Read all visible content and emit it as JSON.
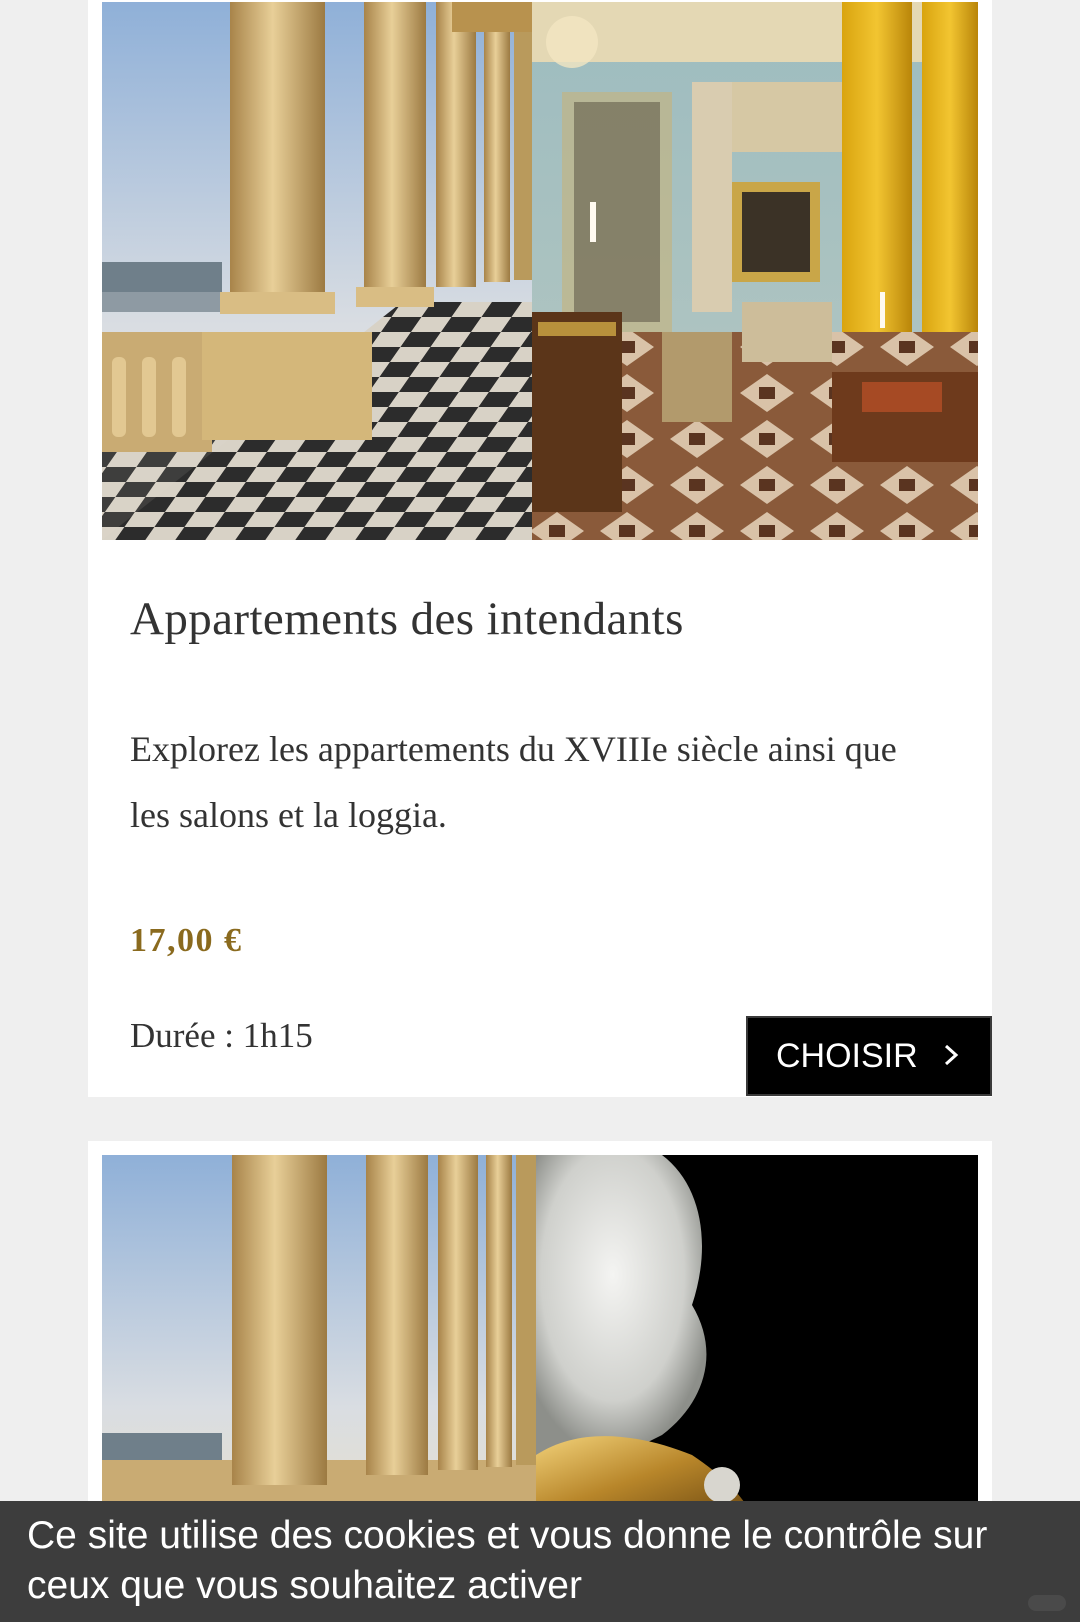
{
  "offers": [
    {
      "image_icon": "colonnade-and-salon-photo",
      "title": "Appartements des intendants",
      "description": "Explorez les appartements du XVIIIe siècle ainsi que les salons et la loggia.",
      "price": "17,00 €",
      "duration": "Durée : 1h15",
      "button_label": "CHOISIR"
    },
    {
      "image_icon": "colonnade-and-bust-photo"
    }
  ],
  "cookie_banner": {
    "text": "Ce site utilise des cookies et vous donne le contrôle sur ceux que vous souhaitez activer"
  },
  "colors": {
    "accent_price": "#8a6a1e",
    "button_bg": "#000000",
    "banner_bg": "#3d3d3d",
    "page_bg": "#efefef"
  }
}
